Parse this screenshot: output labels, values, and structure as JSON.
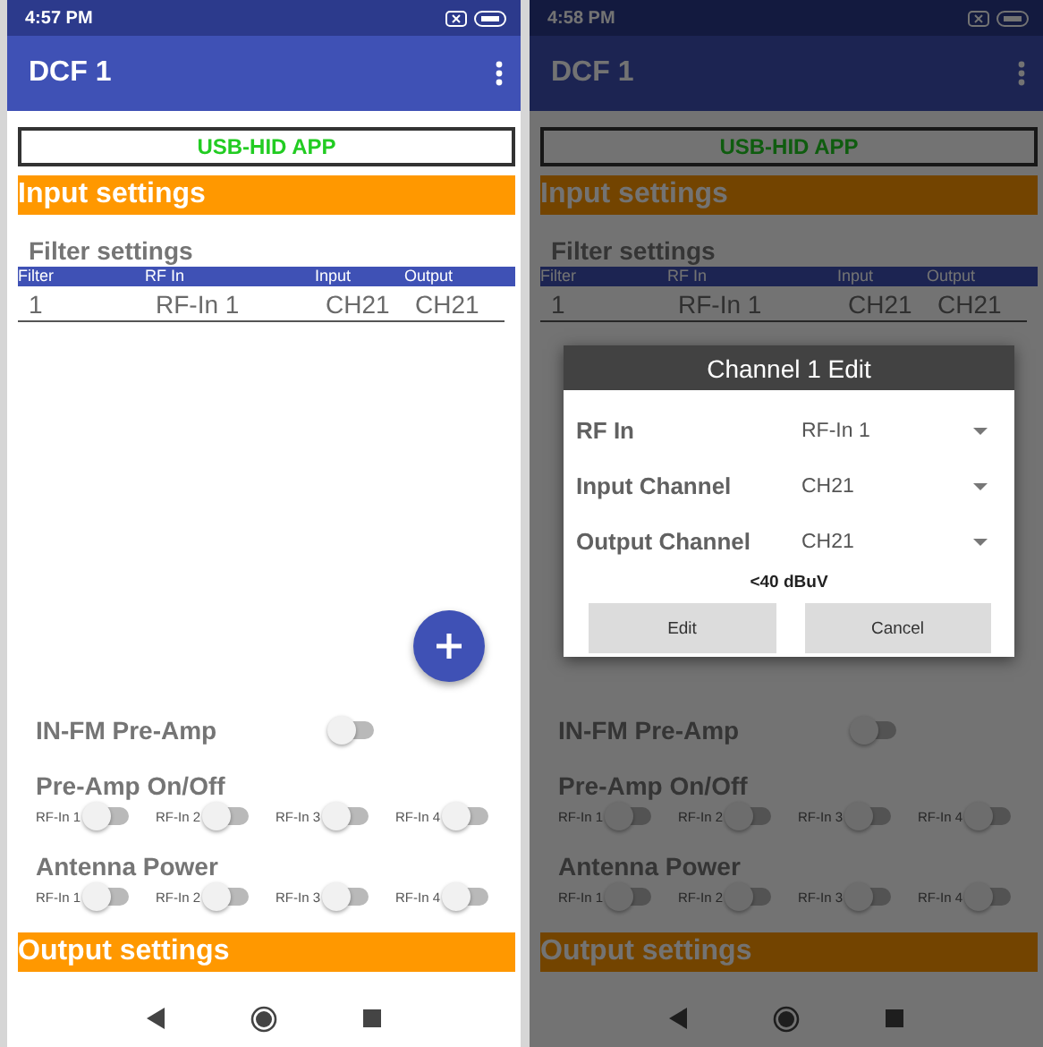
{
  "screens": [
    {
      "status_time": "4:57 PM",
      "app_title": "DCF 1",
      "banner": "USB-HID APP",
      "input_title": "Input settings",
      "filter_title": "Filter settings",
      "columns": [
        "Filter",
        "RF In",
        "Input",
        "Output"
      ],
      "rows": [
        [
          "1",
          "RF-In 1",
          "CH21",
          "CH21"
        ]
      ],
      "fab": true,
      "fm_preamp": {
        "label": "IN-FM Pre-Amp",
        "on": false
      },
      "preamp": {
        "title": "Pre-Amp On/Off",
        "switches": [
          {
            "label": "RF-In 1",
            "on": false
          },
          {
            "label": "RF-In 2",
            "on": false
          },
          {
            "label": "RF-In 3",
            "on": false
          },
          {
            "label": "RF-In 4",
            "on": false
          }
        ]
      },
      "antenna": {
        "title": "Antenna Power",
        "switches": [
          {
            "label": "RF-In 1",
            "on": false
          },
          {
            "label": "RF-In 2",
            "on": false
          },
          {
            "label": "RF-In 3",
            "on": false
          },
          {
            "label": "RF-In 4",
            "on": false
          }
        ]
      },
      "output_title": "Output settings"
    },
    {
      "status_time": "4:58 PM",
      "app_title": "DCF 1",
      "banner": "USB-HID APP",
      "input_title": "Input settings",
      "filter_title": "Filter settings",
      "columns": [
        "Filter",
        "RF In",
        "Input",
        "Output"
      ],
      "rows": [
        [
          "1",
          "RF-In 1",
          "CH21",
          "CH21"
        ]
      ],
      "fm_preamp": {
        "label": "IN-FM Pre-Amp",
        "on": false
      },
      "preamp": {
        "title": "Pre-Amp On/Off",
        "switches": [
          {
            "label": "RF-In 1",
            "on": false
          },
          {
            "label": "RF-In 2",
            "on": false
          },
          {
            "label": "RF-In 3",
            "on": false
          },
          {
            "label": "RF-In 4",
            "on": false
          }
        ]
      },
      "antenna": {
        "title": "Antenna Power",
        "switches": [
          {
            "label": "RF-In 1",
            "on": false
          },
          {
            "label": "RF-In 2",
            "on": false
          },
          {
            "label": "RF-In 3",
            "on": false
          },
          {
            "label": "RF-In 4",
            "on": false
          }
        ]
      },
      "output_title": "Output settings",
      "dialog": {
        "title": "Channel 1 Edit",
        "fields": [
          {
            "label": "RF In",
            "value": "RF-In 1"
          },
          {
            "label": "Input Channel",
            "value": "CH21"
          },
          {
            "label": "Output Channel",
            "value": "CH21"
          }
        ],
        "level_text": "<40 dBuV",
        "buttons": [
          "Edit",
          "Cancel"
        ]
      }
    }
  ]
}
